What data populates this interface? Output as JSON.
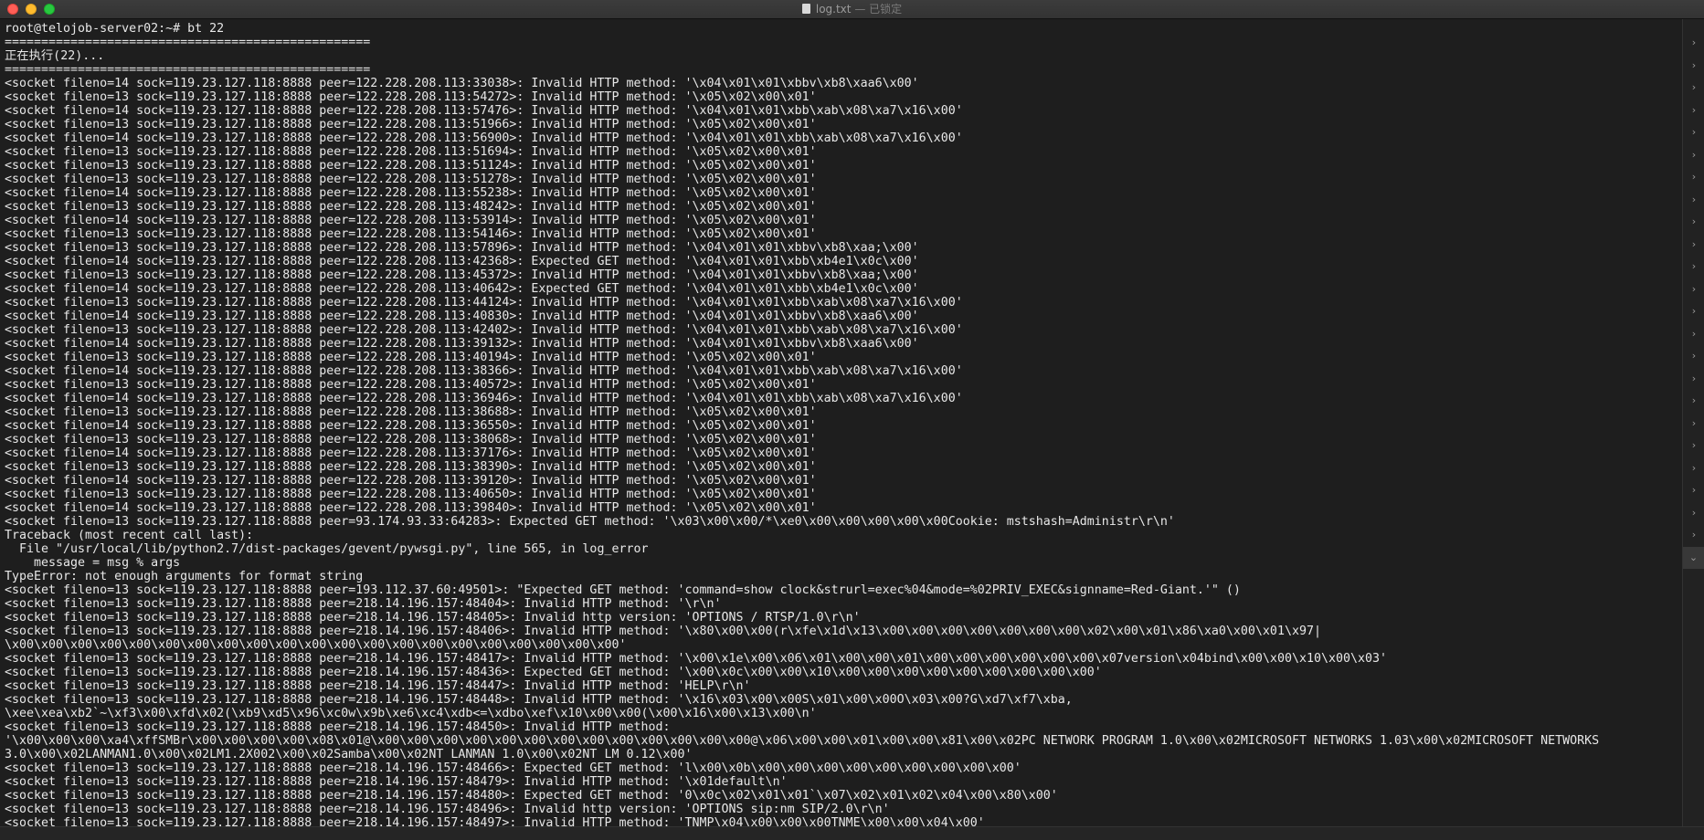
{
  "window": {
    "title": "log.txt",
    "subtitle": "— 已锁定"
  },
  "terminal": {
    "lines": [
      "root@telojob-server02:~# bt 22",
      "==================================================",
      "正在执行(22)...",
      "==================================================",
      "<socket fileno=14 sock=119.23.127.118:8888 peer=122.228.208.113:33038>: Invalid HTTP method: '\\x04\\x01\\x01\\xbbv\\xb8\\xaa6\\x00'",
      "<socket fileno=13 sock=119.23.127.118:8888 peer=122.228.208.113:54272>: Invalid HTTP method: '\\x05\\x02\\x00\\x01'",
      "<socket fileno=14 sock=119.23.127.118:8888 peer=122.228.208.113:57476>: Invalid HTTP method: '\\x04\\x01\\x01\\xbb\\xab\\x08\\xa7\\x16\\x00'",
      "<socket fileno=13 sock=119.23.127.118:8888 peer=122.228.208.113:51966>: Invalid HTTP method: '\\x05\\x02\\x00\\x01'",
      "<socket fileno=14 sock=119.23.127.118:8888 peer=122.228.208.113:56900>: Invalid HTTP method: '\\x04\\x01\\x01\\xbb\\xab\\x08\\xa7\\x16\\x00'",
      "<socket fileno=13 sock=119.23.127.118:8888 peer=122.228.208.113:51694>: Invalid HTTP method: '\\x05\\x02\\x00\\x01'",
      "<socket fileno=13 sock=119.23.127.118:8888 peer=122.228.208.113:51124>: Invalid HTTP method: '\\x05\\x02\\x00\\x01'",
      "<socket fileno=13 sock=119.23.127.118:8888 peer=122.228.208.113:51278>: Invalid HTTP method: '\\x05\\x02\\x00\\x01'",
      "<socket fileno=14 sock=119.23.127.118:8888 peer=122.228.208.113:55238>: Invalid HTTP method: '\\x05\\x02\\x00\\x01'",
      "<socket fileno=13 sock=119.23.127.118:8888 peer=122.228.208.113:48242>: Invalid HTTP method: '\\x05\\x02\\x00\\x01'",
      "<socket fileno=14 sock=119.23.127.118:8888 peer=122.228.208.113:53914>: Invalid HTTP method: '\\x05\\x02\\x00\\x01'",
      "<socket fileno=13 sock=119.23.127.118:8888 peer=122.228.208.113:54146>: Invalid HTTP method: '\\x05\\x02\\x00\\x01'",
      "<socket fileno=13 sock=119.23.127.118:8888 peer=122.228.208.113:57896>: Invalid HTTP method: '\\x04\\x01\\x01\\xbbv\\xb8\\xaa;\\x00'",
      "<socket fileno=14 sock=119.23.127.118:8888 peer=122.228.208.113:42368>: Expected GET method: '\\x04\\x01\\x01\\xbb\\xb4e1\\x0c\\x00'",
      "<socket fileno=13 sock=119.23.127.118:8888 peer=122.228.208.113:45372>: Invalid HTTP method: '\\x04\\x01\\x01\\xbbv\\xb8\\xaa;\\x00'",
      "<socket fileno=14 sock=119.23.127.118:8888 peer=122.228.208.113:40642>: Expected GET method: '\\x04\\x01\\x01\\xbb\\xb4e1\\x0c\\x00'",
      "<socket fileno=13 sock=119.23.127.118:8888 peer=122.228.208.113:44124>: Invalid HTTP method: '\\x04\\x01\\x01\\xbb\\xab\\x08\\xa7\\x16\\x00'",
      "<socket fileno=14 sock=119.23.127.118:8888 peer=122.228.208.113:40830>: Invalid HTTP method: '\\x04\\x01\\x01\\xbbv\\xb8\\xaa6\\x00'",
      "<socket fileno=13 sock=119.23.127.118:8888 peer=122.228.208.113:42402>: Invalid HTTP method: '\\x04\\x01\\x01\\xbb\\xab\\x08\\xa7\\x16\\x00'",
      "<socket fileno=14 sock=119.23.127.118:8888 peer=122.228.208.113:39132>: Invalid HTTP method: '\\x04\\x01\\x01\\xbbv\\xb8\\xaa6\\x00'",
      "<socket fileno=13 sock=119.23.127.118:8888 peer=122.228.208.113:40194>: Invalid HTTP method: '\\x05\\x02\\x00\\x01'",
      "<socket fileno=14 sock=119.23.127.118:8888 peer=122.228.208.113:38366>: Invalid HTTP method: '\\x04\\x01\\x01\\xbb\\xab\\x08\\xa7\\x16\\x00'",
      "<socket fileno=13 sock=119.23.127.118:8888 peer=122.228.208.113:40572>: Invalid HTTP method: '\\x05\\x02\\x00\\x01'",
      "<socket fileno=14 sock=119.23.127.118:8888 peer=122.228.208.113:36946>: Invalid HTTP method: '\\x04\\x01\\x01\\xbb\\xab\\x08\\xa7\\x16\\x00'",
      "<socket fileno=13 sock=119.23.127.118:8888 peer=122.228.208.113:38688>: Invalid HTTP method: '\\x05\\x02\\x00\\x01'",
      "<socket fileno=14 sock=119.23.127.118:8888 peer=122.228.208.113:36550>: Invalid HTTP method: '\\x05\\x02\\x00\\x01'",
      "<socket fileno=13 sock=119.23.127.118:8888 peer=122.228.208.113:38068>: Invalid HTTP method: '\\x05\\x02\\x00\\x01'",
      "<socket fileno=14 sock=119.23.127.118:8888 peer=122.228.208.113:37176>: Invalid HTTP method: '\\x05\\x02\\x00\\x01'",
      "<socket fileno=13 sock=119.23.127.118:8888 peer=122.228.208.113:38390>: Invalid HTTP method: '\\x05\\x02\\x00\\x01'",
      "<socket fileno=14 sock=119.23.127.118:8888 peer=122.228.208.113:39120>: Invalid HTTP method: '\\x05\\x02\\x00\\x01'",
      "<socket fileno=13 sock=119.23.127.118:8888 peer=122.228.208.113:40650>: Invalid HTTP method: '\\x05\\x02\\x00\\x01'",
      "<socket fileno=14 sock=119.23.127.118:8888 peer=122.228.208.113:39840>: Invalid HTTP method: '\\x05\\x02\\x00\\x01'",
      "<socket fileno=13 sock=119.23.127.118:8888 peer=93.174.93.33:64283>: Expected GET method: '\\x03\\x00\\x00/*\\xe0\\x00\\x00\\x00\\x00\\x00Cookie: mstshash=Administr\\r\\n'",
      "Traceback (most recent call last):",
      "  File \"/usr/local/lib/python2.7/dist-packages/gevent/pywsgi.py\", line 565, in log_error",
      "    message = msg % args",
      "TypeError: not enough arguments for format string",
      "<socket fileno=13 sock=119.23.127.118:8888 peer=193.112.37.60:49501>: \"Expected GET method: 'command=show clock&strurl=exec%04&mode=%02PRIV_EXEC&signname=Red-Giant.'\" ()",
      "<socket fileno=13 sock=119.23.127.118:8888 peer=218.14.196.157:48404>: Invalid HTTP method: '\\r\\n'",
      "<socket fileno=13 sock=119.23.127.118:8888 peer=218.14.196.157:48405>: Invalid http version: 'OPTIONS / RTSP/1.0\\r\\n'",
      "<socket fileno=13 sock=119.23.127.118:8888 peer=218.14.196.157:48406>: Invalid HTTP method: '\\x80\\x00\\x00(r\\xfe\\x1d\\x13\\x00\\x00\\x00\\x00\\x00\\x00\\x00\\x02\\x00\\x01\\x86\\xa0\\x00\\x01\\x97|",
      "\\x00\\x00\\x00\\x00\\x00\\x00\\x00\\x00\\x00\\x00\\x00\\x00\\x00\\x00\\x00\\x00\\x00\\x00\\x00\\x00\\x00'",
      "<socket fileno=13 sock=119.23.127.118:8888 peer=218.14.196.157:48417>: Invalid HTTP method: '\\x00\\x1e\\x00\\x06\\x01\\x00\\x00\\x01\\x00\\x00\\x00\\x00\\x00\\x00\\x07version\\x04bind\\x00\\x00\\x10\\x00\\x03'",
      "<socket fileno=13 sock=119.23.127.118:8888 peer=218.14.196.157:48436>: Expected GET method: '\\x00\\x0c\\x00\\x00\\x10\\x00\\x00\\x00\\x00\\x00\\x00\\x00\\x00\\x00'",
      "<socket fileno=13 sock=119.23.127.118:8888 peer=218.14.196.157:48447>: Invalid HTTP method: 'HELP\\r\\n'",
      "<socket fileno=13 sock=119.23.127.118:8888 peer=218.14.196.157:48448>: Invalid HTTP method: '\\x16\\x03\\x00\\x00S\\x01\\x00\\x00O\\x03\\x00?G\\xd7\\xf7\\xba,",
      "\\xee\\xea\\xb2`~\\xf3\\x00\\xfd\\x02(\\xb9\\xd5\\x96\\xc0w\\x9b\\xe6\\xc4\\xdb<=\\xdbo\\xef\\x10\\x00\\x00(\\x00\\x16\\x00\\x13\\x00\\n'",
      "<socket fileno=13 sock=119.23.127.118:8888 peer=218.14.196.157:48450>: Invalid HTTP method:",
      "'\\x00\\x00\\x00\\xa4\\xffSMBr\\x00\\x00\\x00\\x00\\x08\\x01@\\x00\\x00\\x00\\x00\\x00\\x00\\x00\\x00\\x00\\x00\\x00\\x00\\x00@\\x06\\x00\\x00\\x01\\x00\\x00\\x81\\x00\\x02PC NETWORK PROGRAM 1.0\\x00\\x02MICROSOFT NETWORKS 1.03\\x00\\x02MICROSOFT NETWORKS",
      "3.0\\x00\\x02LANMAN1.0\\x00\\x02LM1.2X002\\x00\\x02Samba\\x00\\x02NT LANMAN 1.0\\x00\\x02NT LM 0.12\\x00'",
      "<socket fileno=13 sock=119.23.127.118:8888 peer=218.14.196.157:48466>: Expected GET method: 'l\\x00\\x0b\\x00\\x00\\x00\\x00\\x00\\x00\\x00\\x00\\x00'",
      "<socket fileno=13 sock=119.23.127.118:8888 peer=218.14.196.157:48479>: Invalid HTTP method: '\\x01default\\n'",
      "<socket fileno=13 sock=119.23.127.118:8888 peer=218.14.196.157:48480>: Expected GET method: '0\\x0c\\x02\\x01\\x01`\\x07\\x02\\x01\\x02\\x04\\x00\\x80\\x00'",
      "<socket fileno=13 sock=119.23.127.118:8888 peer=218.14.196.157:48496>: Invalid http version: 'OPTIONS sip:nm SIP/2.0\\r\\n'",
      "<socket fileno=13 sock=119.23.127.118:8888 peer=218.14.196.157:48497>: Invalid HTTP method: 'TNMP\\x04\\x00\\x00\\x00TNME\\x00\\x00\\x04\\x00'"
    ]
  },
  "sidebar": {
    "chevron_count": 23,
    "icon": "chevron-right-icon"
  },
  "colors": {
    "background": "#1e1e1e",
    "text": "#e8e8e8"
  }
}
